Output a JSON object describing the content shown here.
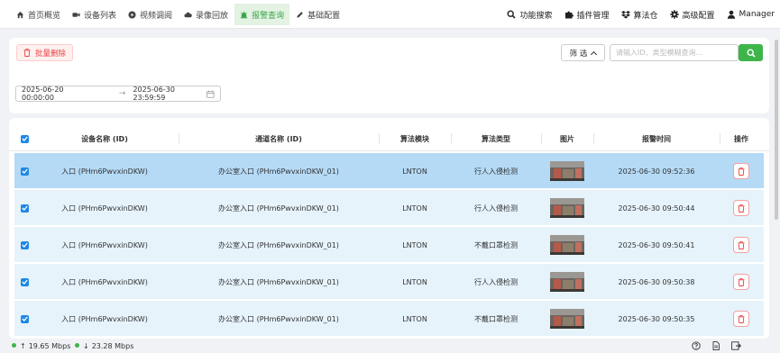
{
  "nav": {
    "items": [
      {
        "label": "首页概览",
        "icon": "home-icon"
      },
      {
        "label": "设备列表",
        "icon": "video-camera-icon"
      },
      {
        "label": "视频调阅",
        "icon": "play-circle-icon"
      },
      {
        "label": "录像回放",
        "icon": "cloud-icon"
      },
      {
        "label": "报警查询",
        "icon": "alarm-icon"
      },
      {
        "label": "基础配置",
        "icon": "edit-icon"
      }
    ],
    "active": "报警查询",
    "right": [
      {
        "label": "功能搜索",
        "icon": "search-icon"
      },
      {
        "label": "插件管理",
        "icon": "puzzle-icon"
      },
      {
        "label": "算法仓",
        "icon": "dropbox-icon"
      },
      {
        "label": "高级配置",
        "icon": "gear-icon"
      },
      {
        "label": "Manager",
        "icon": "user-icon"
      }
    ]
  },
  "toolbar": {
    "batch_delete": "批量删除",
    "filter_label": "筛 选",
    "search_placeholder": "请输入ID、类型模糊查询..."
  },
  "date_range": {
    "start": "2025-06-20 00:00:00",
    "end": "2025-06-30 23:59:59"
  },
  "table": {
    "headers": [
      "设备名称 (ID)",
      "通道名称 (ID)",
      "算法模块",
      "算法类型",
      "图片",
      "报警时间",
      "操作"
    ],
    "rows": [
      {
        "device": "入口 (PHm6PwvxinDKW)",
        "channel": "办公室入口 (PHm6PwvxinDKW_01)",
        "module": "LNTON",
        "type": "行人入侵检测",
        "time": "2025-06-30 09:52:36",
        "selected": true
      },
      {
        "device": "入口 (PHm6PwvxinDKW)",
        "channel": "办公室入口 (PHm6PwvxinDKW_01)",
        "module": "LNTON",
        "type": "行人入侵检测",
        "time": "2025-06-30 09:50:44",
        "selected": true
      },
      {
        "device": "入口 (PHm6PwvxinDKW)",
        "channel": "办公室入口 (PHm6PwvxinDKW_01)",
        "module": "LNTON",
        "type": "不戴口罩检测",
        "time": "2025-06-30 09:50:41",
        "selected": true
      },
      {
        "device": "入口 (PHm6PwvxinDKW)",
        "channel": "办公室入口 (PHm6PwvxinDKW_01)",
        "module": "LNTON",
        "type": "行人入侵检测",
        "time": "2025-06-30 09:50:38",
        "selected": true
      },
      {
        "device": "入口 (PHm6PwvxinDKW)",
        "channel": "办公室入口 (PHm6PwvxinDKW_01)",
        "module": "LNTON",
        "type": "不戴口罩检测",
        "time": "2025-06-30 09:50:35",
        "selected": true
      }
    ]
  },
  "status": {
    "upload": "19.65 Mbps",
    "download": "23.28 Mbps"
  },
  "colors": {
    "accent": "#3db54a",
    "selection": "#1e88e5",
    "danger": "#e64545",
    "row_bg": "#e6f3fb",
    "row_highlight": "#b5daf6"
  }
}
